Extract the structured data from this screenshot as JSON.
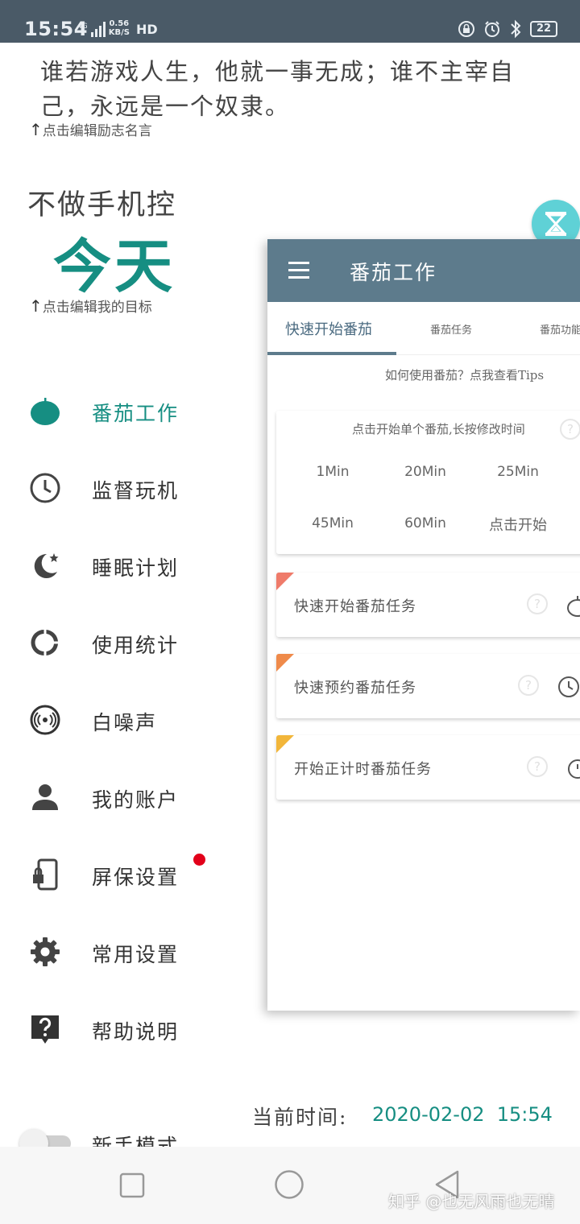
{
  "status_bar": {
    "time": "15:54",
    "network": "4G",
    "speed_value": "0.56",
    "speed_unit": "KB/S",
    "hd": "HD",
    "battery": "22"
  },
  "quote": {
    "text": "谁若游戏人生，他就一事无成；谁不主宰自己，永远是一个奴隶。",
    "hint": "点击编辑励志名言"
  },
  "goal": {
    "title": "不做手机控",
    "value": "今天",
    "hint": "点击编辑我的目标"
  },
  "menu": {
    "items": [
      {
        "label": "番茄工作",
        "icon": "tomato-icon"
      },
      {
        "label": "监督玩机",
        "icon": "clock-icon"
      },
      {
        "label": "睡眠计划",
        "icon": "moon-star-icon"
      },
      {
        "label": "使用统计",
        "icon": "donut-chart-icon"
      },
      {
        "label": "白噪声",
        "icon": "disc-sound-icon"
      },
      {
        "label": "我的账户",
        "icon": "person-icon"
      },
      {
        "label": "屏保设置",
        "icon": "lock-phone-icon"
      },
      {
        "label": "常用设置",
        "icon": "gear-icon"
      },
      {
        "label": "帮助说明",
        "icon": "help-icon"
      }
    ],
    "toggle_label": "新手模式"
  },
  "panel": {
    "title": "番茄工作",
    "tabs": [
      {
        "label": "快速开始番茄"
      },
      {
        "label": "番茄任务"
      },
      {
        "label": "番茄功能"
      }
    ],
    "tips": "如何使用番茄？点我查看Tips",
    "timer_hint": "点击开始单个番茄,长按修改时间",
    "timer_options": [
      "1Min",
      "20Min",
      "25Min",
      "45Min",
      "60Min",
      "点击开始"
    ],
    "tasks": [
      {
        "label": "快速开始番茄任务",
        "color": "#ef7b6a"
      },
      {
        "label": "快速预约番茄任务",
        "color": "#ef8a4a"
      },
      {
        "label": "开始正计时番茄任务",
        "color": "#f2b63a"
      }
    ]
  },
  "current_time": {
    "label": "当前时间:",
    "value": "2020-02-02  15:54"
  },
  "watermark": "知乎 @也无风雨也无晴",
  "colors": {
    "accent": "#168e82",
    "header": "#5d7b8c",
    "status_bar": "#4a5a67",
    "notification_dot": "#e2001a"
  }
}
